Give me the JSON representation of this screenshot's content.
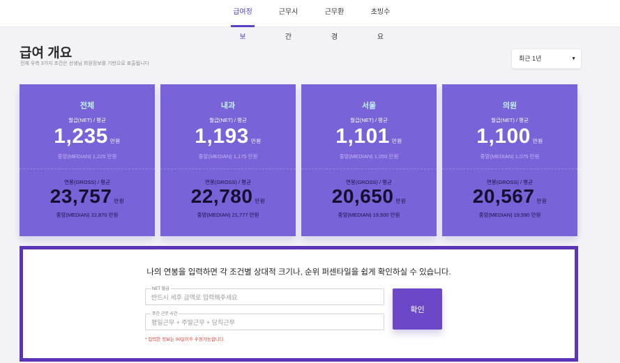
{
  "nav": {
    "tabs": [
      {
        "label": "급여정보",
        "active": true
      },
      {
        "label": "근무시간",
        "active": false
      },
      {
        "label": "근무환경",
        "active": false
      },
      {
        "label": "초빙수요",
        "active": false
      }
    ]
  },
  "header": {
    "title": "급여 개요",
    "subtitle": "전체 우측 3가지 조건은 선생님 회원정보를 기반으로 표출됩니다",
    "period": "최근 1년"
  },
  "cards": [
    {
      "name": "전체",
      "net_label": "월급(NET) / 평균",
      "net_value": "1,235",
      "net_unit": "만원",
      "net_median": "중앙(MEDIAN) 1,225 만원",
      "gross_label": "연봉(GROSS) / 평균",
      "gross_value": "23,757",
      "gross_unit": "만원",
      "gross_median": "중앙(MEDIAN) 22,870 만원"
    },
    {
      "name": "내과",
      "net_label": "월급(NET) / 평균",
      "net_value": "1,193",
      "net_unit": "만원",
      "net_median": "중앙(MEDIAN) 1,175 만원",
      "gross_label": "연봉(GROSS) / 평균",
      "gross_value": "22,780",
      "gross_unit": "만원",
      "gross_median": "중앙(MEDIAN) 21,777 만원"
    },
    {
      "name": "서울",
      "net_label": "월급(NET) / 평균",
      "net_value": "1,101",
      "net_unit": "만원",
      "net_median": "중앙(MEDIAN) 1,050 만원",
      "gross_label": "연봉(GROSS) / 평균",
      "gross_value": "20,650",
      "gross_unit": "만원",
      "gross_median": "중앙(MEDIAN) 19,500 만원"
    },
    {
      "name": "의원",
      "net_label": "월급(NET) / 평균",
      "net_value": "1,100",
      "net_unit": "만원",
      "net_median": "중앙(MEDIAN) 1,075 만원",
      "gross_label": "연봉(GROSS) / 평균",
      "gross_value": "20,567",
      "gross_unit": "만원",
      "gross_median": "중앙(MEDIAN) 19,590 만원"
    }
  ],
  "form": {
    "heading": "나의 연봉을 입력하면 각 조건별 상대적 크기나, 순위 퍼센타일을 쉽게 확인하실 수 있습니다.",
    "net_label": "NET 월급",
    "net_placeholder": "반드시 세후 금액로 입력해주세요",
    "hours_label": "주간 근무 시간",
    "hours_placeholder": "평일근무 + 주말근무 + 당직근무",
    "confirm_label": "확인",
    "note": "* 입력한 정보는 90일이후 수정가능합니다."
  },
  "colors": {
    "accent": "#5b3fc4",
    "card_bg": "#7a62d8",
    "card_name": "#bff4ff",
    "panel_border": "#5b35b8",
    "note": "#e0413a"
  }
}
